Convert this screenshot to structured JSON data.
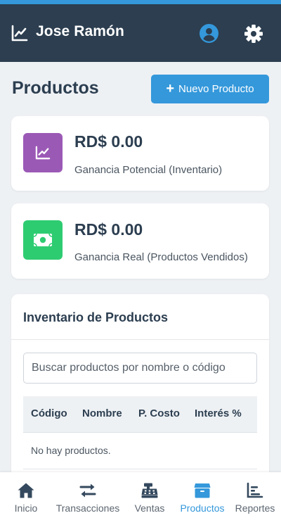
{
  "header": {
    "title": "Jose Ramón",
    "logo_icon": "chart-line-icon",
    "user_icon": "user-circle-icon",
    "settings_icon": "gear-icon"
  },
  "page": {
    "title": "Productos",
    "new_button_label": "Nuevo Producto"
  },
  "stats": [
    {
      "amount": "RD$ 0.00",
      "caption": "Ganancia Potencial (Inventario)",
      "icon": "chart-line-icon",
      "color": "#9b59b6"
    },
    {
      "amount": "RD$ 0.00",
      "caption": "Ganancia Real (Productos Vendidos)",
      "icon": "money-bill-icon",
      "color": "#2ecc71"
    }
  ],
  "inventory": {
    "title": "Inventario de Productos",
    "search_placeholder": "Buscar productos por nombre o código",
    "columns": [
      "Código",
      "Nombre",
      "P. Costo",
      "Interés %"
    ],
    "empty_message": "No hay productos."
  },
  "nav": {
    "items": [
      {
        "label": "Inicio",
        "icon": "home-icon"
      },
      {
        "label": "Transacciones",
        "icon": "exchange-icon"
      },
      {
        "label": "Ventas",
        "icon": "cash-register-icon"
      },
      {
        "label": "Productos",
        "icon": "box-icon",
        "active": true
      },
      {
        "label": "Reportes",
        "icon": "bar-chart-icon"
      }
    ]
  },
  "colors": {
    "header_bg": "#2c3e50",
    "accent": "#3498db",
    "purple": "#9b59b6",
    "green": "#2ecc71"
  }
}
